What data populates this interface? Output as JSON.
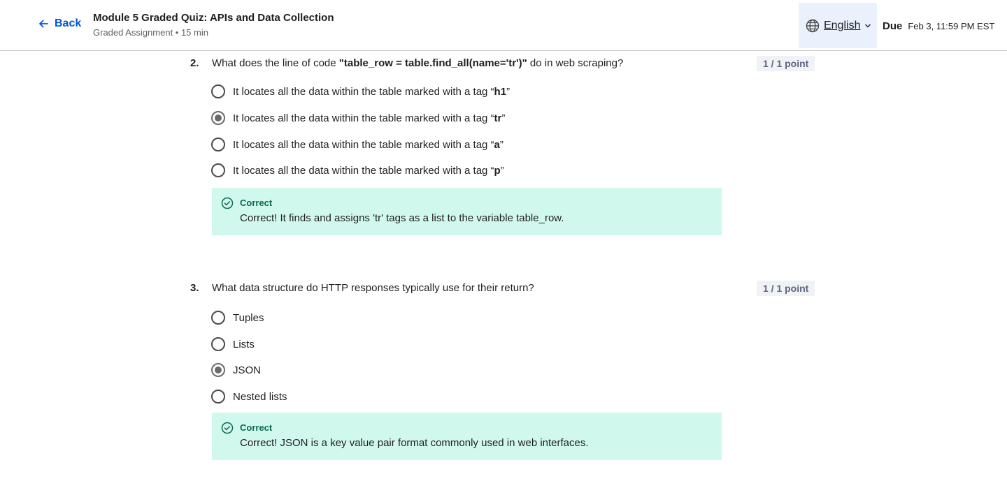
{
  "header": {
    "back_label": "Back",
    "title": "Module 5 Graded Quiz: APIs and Data Collection",
    "subtitle": "Graded Assignment • 15 min",
    "language": "English",
    "due_label": "Due",
    "due_date": "Feb 3, 11:59 PM EST"
  },
  "questions": [
    {
      "number": "2.",
      "text_prefix": "What does the line of code ",
      "text_code": "\"table_row = table.find_all(name='tr')\"",
      "text_suffix": " do in web scraping?",
      "points": "1 / 1 point",
      "options": [
        {
          "prefix": "It locates all the data within the table marked with a tag “",
          "bold": "h1",
          "suffix": "”",
          "selected": false
        },
        {
          "prefix": "It locates all the data within the table marked with a tag “",
          "bold": "tr",
          "suffix": "”",
          "selected": true
        },
        {
          "prefix": "It locates all the data within the table marked with a tag “",
          "bold": "a",
          "suffix": "”",
          "selected": false
        },
        {
          "prefix": "It locates all the data within the table marked with a tag “",
          "bold": "p",
          "suffix": "”",
          "selected": false
        }
      ],
      "feedback_title": "Correct",
      "feedback_text": "Correct! It finds and assigns 'tr' tags as a list to the variable table_row."
    },
    {
      "number": "3.",
      "text": "What data structure do HTTP responses typically use for their return?",
      "points": "1 / 1 point",
      "options": [
        {
          "label": "Tuples",
          "selected": false
        },
        {
          "label": "Lists",
          "selected": false
        },
        {
          "label": "JSON",
          "selected": true
        },
        {
          "label": "Nested lists",
          "selected": false
        }
      ],
      "feedback_title": "Correct",
      "feedback_text": "Correct! JSON is a key value pair format commonly used in web interfaces."
    }
  ],
  "colors": {
    "accent": "#0056d2",
    "feedback_bg": "#d1f8ec",
    "feedback_title": "#0a6b4b",
    "points_bg": "#f0f2f5"
  },
  "icons": {
    "back": "arrow-left-icon",
    "language": "globe-icon",
    "dropdown": "chevron-down-icon",
    "feedback": "check-circle-icon"
  }
}
